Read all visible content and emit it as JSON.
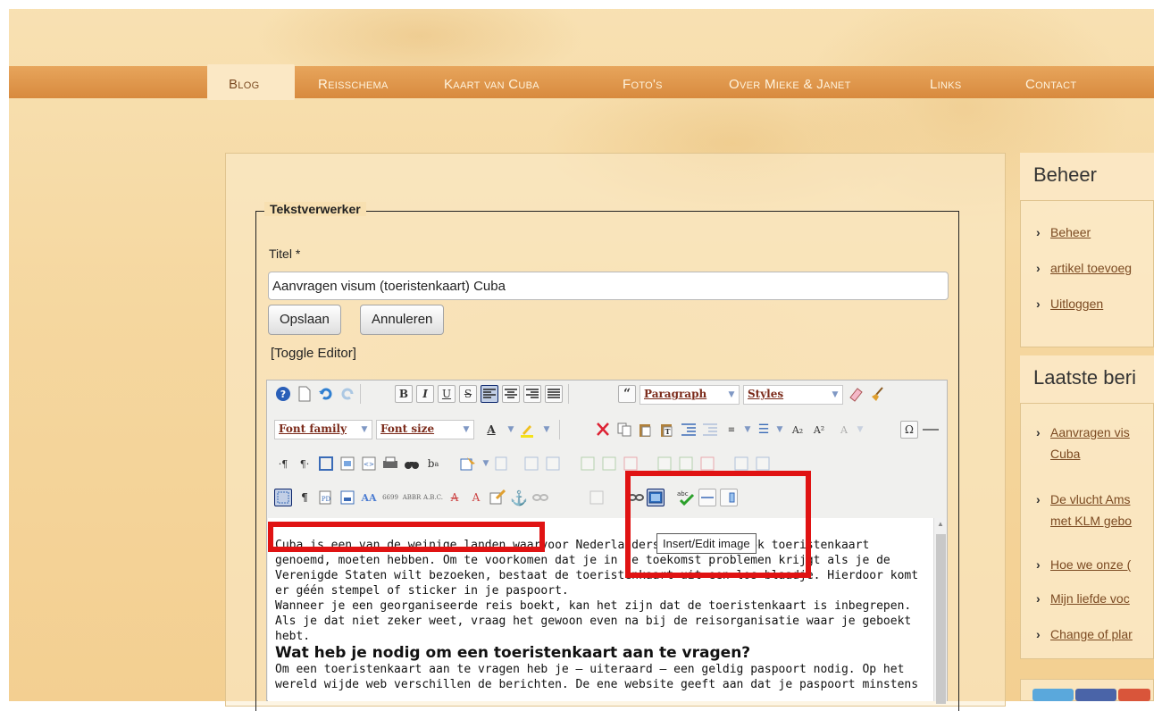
{
  "nav": {
    "items": [
      "Blog",
      "Reisschema",
      "Kaart van Cuba",
      "Foto's",
      "Over Mieke & Janet",
      "Links",
      "Contact"
    ],
    "active": "Blog"
  },
  "form": {
    "legend": "Tekstverwerker",
    "title_label": "Titel *",
    "title_value": "Aanvragen visum (toeristenkaart) Cuba",
    "save_label": "Opslaan",
    "cancel_label": "Annuleren",
    "toggle_label": "[Toggle Editor]"
  },
  "toolbar": {
    "paragraph": "Paragraph",
    "styles": "Styles",
    "font_family": "Font family",
    "font_size": "Font size",
    "tooltip": "Insert/Edit image"
  },
  "editor_content": {
    "p1": "Cuba is een van de weinige landen waarvoor Nederlanders een visum, ook toeristenkaart genoemd, moeten hebben. Om te voorkomen dat je in de toekomst problemen krijgt als je de Verenigde Staten wilt bezoeken, bestaat de toeristenkaart uit een los blaadje. Hierdoor komt er géén stempel of sticker in je paspoort.",
    "p2": "Wanneer je een georganiseerde reis boekt, kan het zijn dat de toeristenkaart is inbegrepen. Als je dat niet zeker weet, vraag het gewoon even na bij de reisorganisatie waar je geboekt hebt.",
    "heading": "Wat heb je nodig om een toeristenkaart aan te vragen?",
    "p3": "Om een toeristenkaart aan te vragen heb je – uiteraard – een geldig paspoort nodig. Op het wereld wijde web verschillen de berichten. De ene website geeft aan dat je paspoort minstens"
  },
  "sidebar": {
    "beheer_title": "Beheer",
    "beheer_links": [
      "Beheer",
      "artikel toevoeg",
      "Uitloggen"
    ],
    "recent_title": "Laatste beri",
    "recent_links": [
      "Aanvragen vis",
      "Cuba",
      "De vlucht Ams",
      "met KLM gebo",
      "Hoe we onze (",
      "Mijn liefde voc",
      "Change of plar"
    ]
  },
  "colors": {
    "nav_bar": "#d88a3e",
    "highlight_red": "#e01313",
    "link_brown": "#7b4a22"
  }
}
